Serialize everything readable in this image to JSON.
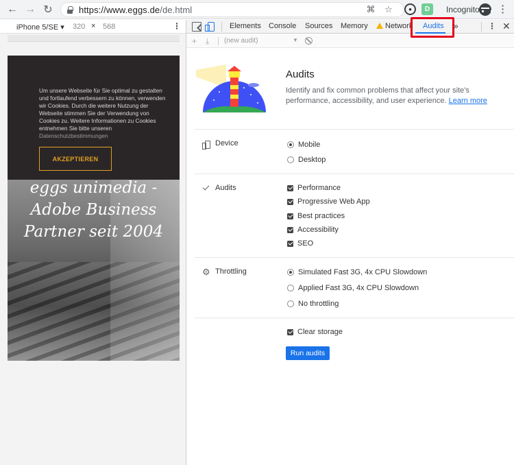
{
  "browser": {
    "url_host": "https://www.eggs.de",
    "url_path": "/de.html",
    "incognito_label": "Incognito",
    "extension_label": "D"
  },
  "device_toolbar": {
    "device": "iPhone 5/SE",
    "width": "320",
    "times": "×",
    "height": "568"
  },
  "page": {
    "cookie_text": "Um unsere Webseite für Sie optimal zu gestalten und fortlaufend verbessern zu können, verwenden wir Cookies. Durch die weitere Nutzung der Webseite stimmen Sie der Verwendung von Cookies zu. Weitere Informationen zu Cookies entnehmen Sie bitte unseren",
    "cookie_link": "Datenschutzbestimmungen",
    "accept_button": "AKZEPTIEREN",
    "hero_line1": "eggs unimedia -",
    "hero_line2": "Adobe Business",
    "hero_line3": "Partner seit 2004"
  },
  "devtools": {
    "tabs": [
      "Elements",
      "Console",
      "Sources",
      "Memory",
      "Network",
      "Audits"
    ],
    "active_tab": "Audits",
    "new_audit_placeholder": "(new audit)",
    "more_tabs": "»"
  },
  "audits": {
    "title": "Audits",
    "description": "Identify and fix common problems that affect your site's performance, accessibility, and user experience.",
    "learn_more": "Learn more",
    "device_label": "Device",
    "device_options": [
      {
        "label": "Mobile",
        "selected": true
      },
      {
        "label": "Desktop",
        "selected": false
      }
    ],
    "audits_label": "Audits",
    "audit_options": [
      {
        "label": "Performance",
        "checked": true
      },
      {
        "label": "Progressive Web App",
        "checked": true
      },
      {
        "label": "Best practices",
        "checked": true
      },
      {
        "label": "Accessibility",
        "checked": true
      },
      {
        "label": "SEO",
        "checked": true
      }
    ],
    "throttling_label": "Throttling",
    "throttling_options": [
      {
        "label": "Simulated Fast 3G, 4x CPU Slowdown",
        "selected": true
      },
      {
        "label": "Applied Fast 3G, 4x CPU Slowdown",
        "selected": false
      },
      {
        "label": "No throttling",
        "selected": false
      }
    ],
    "clear_storage": "Clear storage",
    "run_button": "Run audits"
  },
  "colors": {
    "accent": "#1a73e8",
    "highlight": "#e3001b",
    "cookie_accent": "#e0a020"
  }
}
